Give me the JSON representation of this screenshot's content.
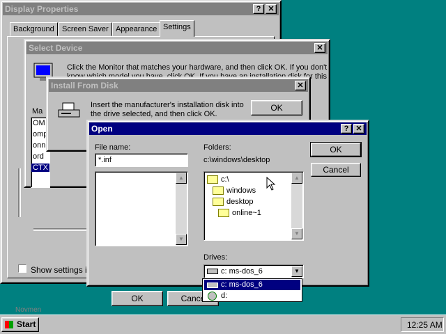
{
  "display_props": {
    "title": "Display Properties",
    "help": "?",
    "close": "✕",
    "tabs": [
      "Background",
      "Screen Saver",
      "Appearance",
      "Settings"
    ],
    "show_settings_label": "Show settings ico",
    "ok_label": "OK",
    "cancel_label": "Cance",
    "partial_list": [
      "OM",
      "omp",
      "onn",
      "ord",
      "CTX"
    ],
    "list_prefix": "Ma",
    "bottom_text": "Novmen"
  },
  "select_device": {
    "title": "Select Device",
    "close": "✕",
    "message_line1": "Click the Monitor that matches your hardware, and then click OK. If you don't",
    "message_line2": "know which model you have, click OK. If you have an installation disk for this"
  },
  "install_disk": {
    "title": "Install From Disk",
    "close": "✕",
    "message_line1": "Insert the manufacturer's installation disk into",
    "message_line2": "the drive selected, and then click OK.",
    "ok_label": "OK"
  },
  "open_dialog": {
    "title": "Open",
    "help": "?",
    "close": "✕",
    "file_name_label": "File name:",
    "file_name_value": "*.inf",
    "folders_label": "Folders:",
    "current_path": "c:\\windows\\desktop",
    "folder_tree": [
      "c:\\",
      "windows",
      "desktop",
      "online~1"
    ],
    "drives_label": "Drives:",
    "selected_drive": "c: ms-dos_6",
    "drive_options": [
      "c: ms-dos_6",
      "d:"
    ],
    "ok_label": "OK",
    "cancel_label": "Cancel"
  },
  "taskbar": {
    "start_label": "Start",
    "clock": "12:25 AM"
  },
  "colors": {
    "desktop": "#008080",
    "titlebar_active": "#000080",
    "titlebar_inactive": "#808080",
    "face": "#c0c0c0"
  }
}
